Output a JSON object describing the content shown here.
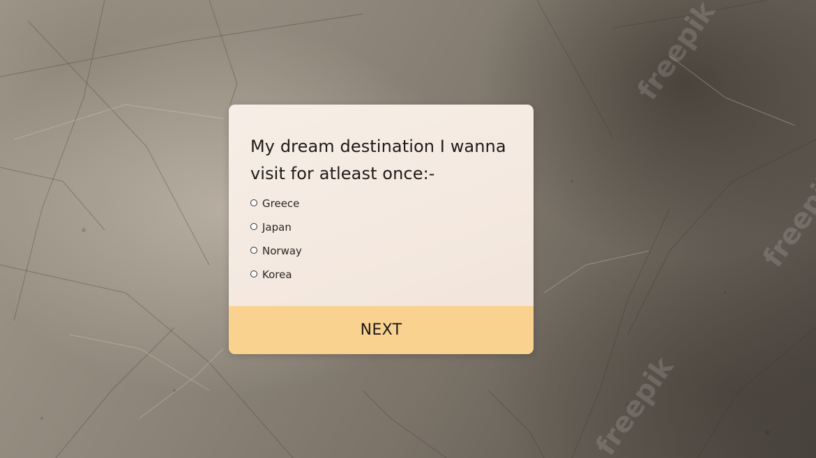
{
  "question": {
    "text": "My dream destination I wanna visit for atleast once:-"
  },
  "options": [
    {
      "label": "Greece",
      "selected": false
    },
    {
      "label": "Japan",
      "selected": false
    },
    {
      "label": "Norway",
      "selected": false
    },
    {
      "label": "Korea",
      "selected": false
    }
  ],
  "actions": {
    "next_label": "NEXT"
  },
  "background": {
    "watermark_text": "freepik"
  },
  "colors": {
    "card": "#f4e9e0",
    "button": "#f9d28f",
    "text": "#1f1a17"
  }
}
